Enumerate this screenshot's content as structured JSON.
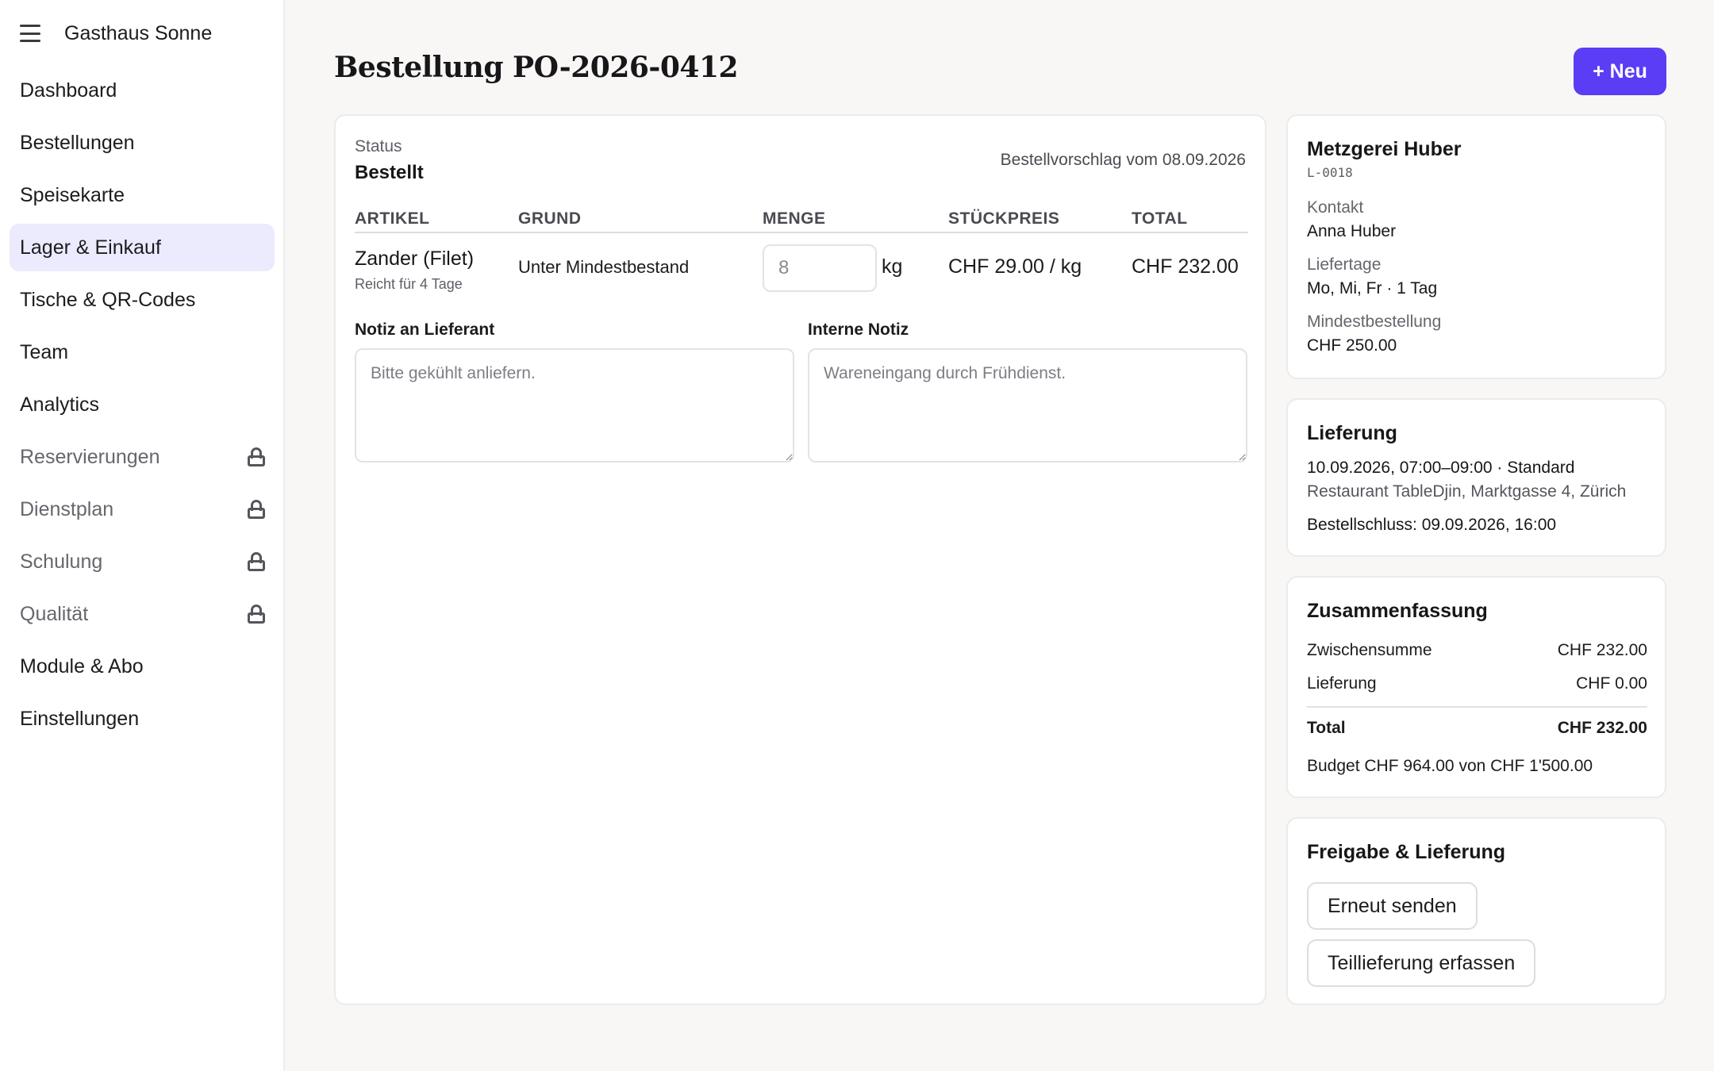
{
  "sidebar": {
    "brand": "Gasthaus Sonne",
    "items": [
      {
        "label": "Dashboard",
        "locked": false,
        "active": false
      },
      {
        "label": "Bestellungen",
        "locked": false,
        "active": false
      },
      {
        "label": "Speisekarte",
        "locked": false,
        "active": false
      },
      {
        "label": "Lager & Einkauf",
        "locked": false,
        "active": true
      },
      {
        "label": "Tische & QR-Codes",
        "locked": false,
        "active": false
      },
      {
        "label": "Team",
        "locked": false,
        "active": false
      },
      {
        "label": "Analytics",
        "locked": false,
        "active": false
      },
      {
        "label": "Reservierungen",
        "locked": true,
        "active": false
      },
      {
        "label": "Dienstplan",
        "locked": true,
        "active": false
      },
      {
        "label": "Schulung",
        "locked": true,
        "active": false
      },
      {
        "label": "Qualität",
        "locked": true,
        "active": false
      },
      {
        "label": "Module & Abo",
        "locked": false,
        "active": false
      },
      {
        "label": "Einstellungen",
        "locked": false,
        "active": false
      }
    ]
  },
  "header": {
    "title": "Bestellung PO-2026-0412",
    "new_button": "+ Neu"
  },
  "order": {
    "status_label": "Status",
    "status_value": "Bestellt",
    "proposal": "Bestellvorschlag vom 08.09.2026",
    "columns": [
      "ARTIKEL",
      "GRUND",
      "MENGE",
      "STÜCKPREIS",
      "TOTAL"
    ],
    "line": {
      "name": "Zander (Filet)",
      "sub": "Reicht für 4 Tage",
      "reason": "Unter Mindestbestand",
      "quantity": "8",
      "unit": "kg",
      "unit_price": "CHF 29.00 / kg",
      "total": "CHF 232.00"
    },
    "note_supplier_label": "Notiz an Lieferant",
    "note_supplier_placeholder": "Bitte gekühlt anliefern.",
    "note_internal_label": "Interne Notiz",
    "note_internal_placeholder": "Wareneingang durch Frühdienst."
  },
  "supplier": {
    "name": "Metzgerei Huber",
    "id": "L-0018",
    "contact_label": "Kontakt",
    "contact_value": "Anna Huber",
    "days_label": "Liefertage",
    "days_value": "Mo, Mi, Fr · 1 Tag",
    "min_label": "Mindestbestellung",
    "min_value": "CHF 250.00"
  },
  "delivery": {
    "title": "Lieferung",
    "slot": "10.09.2026, 07:00–09:00 · Standard",
    "address": "Restaurant TableDjin, Marktgasse 4, Zürich",
    "cutoff": "Bestellschluss: 09.09.2026, 16:00"
  },
  "summary": {
    "title": "Zusammenfassung",
    "subtotal_label": "Zwischensumme",
    "subtotal_value": "CHF 232.00",
    "delivery_label": "Lieferung",
    "delivery_value": "CHF 0.00",
    "total_label": "Total",
    "total_value": "CHF 232.00",
    "budget": "Budget CHF 964.00 von CHF 1'500.00"
  },
  "release": {
    "title": "Freigabe & Lieferung",
    "resend_button": "Erneut senden",
    "partial_button": "Teillieferung erfassen"
  },
  "icons": {
    "menu": "hamburger-icon",
    "lock": "lock-icon"
  },
  "colors": {
    "accent": "#5b3df5",
    "active_nav": "#ecebfd",
    "background": "#f8f7f5"
  }
}
